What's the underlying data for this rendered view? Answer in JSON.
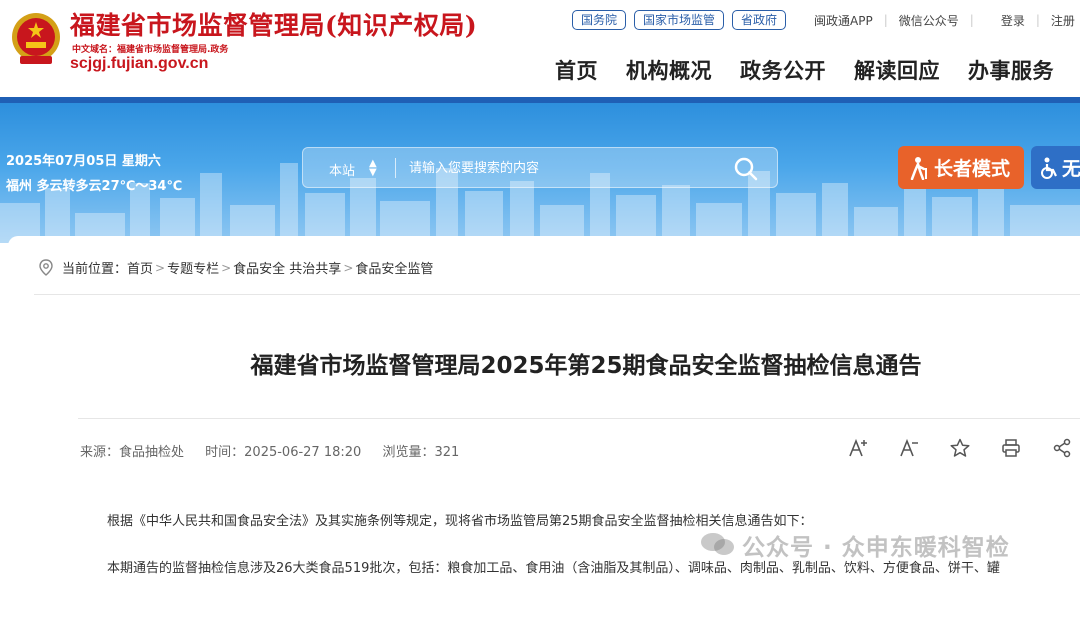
{
  "header": {
    "site_title": "福建省市场监督管理局(知识产权局)",
    "cn_domain": "中文域名：福建省市场监督管理局.政务",
    "domain": "scjgj.fujian.gov.cn",
    "top_pills": [
      "国务院",
      "国家市场监管",
      "省政府"
    ],
    "top_links": [
      "闽政通APP",
      "微信公众号",
      "登录",
      "注册"
    ],
    "nav": [
      "首页",
      "机构概况",
      "政务公开",
      "解读回应",
      "办事服务"
    ]
  },
  "banner": {
    "date": "2025年07月05日 星期六",
    "weather": "福州 多云转多云27℃～34℃",
    "search_scope": "本站",
    "search_placeholder": "请输入您要搜索的内容",
    "elder_mode": "长者模式",
    "accessibility": "无"
  },
  "breadcrumb": {
    "prefix": "当前位置：",
    "items": [
      "首页",
      "专题专栏",
      "食品安全 共治共享",
      "食品安全监管"
    ]
  },
  "article": {
    "title": "福建省市场监督管理局2025年第25期食品安全监督抽检信息通告",
    "source": "来源：食品抽检处",
    "time": "时间：2025-06-27 18:20",
    "views": "浏览量：321",
    "para1": "根据《中华人民共和国食品安全法》及其实施条例等规定，现将省市场监管局第25期食品安全监督抽检相关信息通告如下：",
    "para2": "本期通告的监督抽检信息涉及26大类食品519批次，包括：粮食加工品、食用油（含油脂及其制品）、调味品、肉制品、乳制品、饮料、方便食品、饼干、罐"
  },
  "watermark": "公众号 · 众申东暖科智检",
  "colors": {
    "brand_red": "#c8161d",
    "nav_blue": "#1f5fb5",
    "elder_orange": "#e8622a",
    "access_blue": "#2e6fc6"
  }
}
